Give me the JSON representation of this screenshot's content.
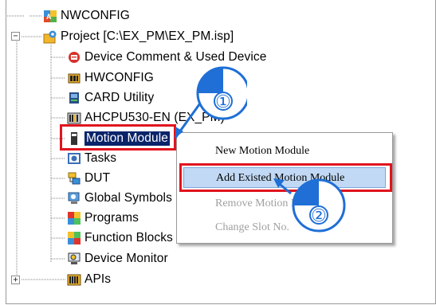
{
  "tree": {
    "items": [
      {
        "label": "NWCONFIG",
        "icon": "network-config-icon"
      },
      {
        "label": "Project [C:\\EX_PM\\EX_PM.isp]",
        "icon": "project-icon",
        "expander": "−"
      },
      {
        "label": "Device Comment & Used Device",
        "icon": "device-comment-icon"
      },
      {
        "label": "HWCONFIG",
        "icon": "hardware-config-icon"
      },
      {
        "label": "CARD Utility",
        "icon": "card-utility-icon"
      },
      {
        "label": "AHCPU530-EN (EX_PM)",
        "icon": "cpu-module-icon"
      },
      {
        "label": "Motion Module",
        "icon": "motion-module-icon"
      },
      {
        "label": "Tasks",
        "icon": "tasks-icon"
      },
      {
        "label": "DUT",
        "icon": "dut-icon"
      },
      {
        "label": "Global Symbols",
        "icon": "global-symbols-icon"
      },
      {
        "label": "Programs",
        "icon": "programs-icon"
      },
      {
        "label": "Function Blocks",
        "icon": "function-blocks-icon"
      },
      {
        "label": "Device Monitor",
        "icon": "device-monitor-icon"
      },
      {
        "label": "APIs",
        "icon": "apis-icon",
        "expander": "+"
      }
    ]
  },
  "context_menu": {
    "items": [
      {
        "label": "New Motion Module",
        "enabled": true
      },
      {
        "label": "Add Existed Motion Module",
        "enabled": true,
        "highlighted": true
      },
      {
        "label": "Remove Motion Module",
        "enabled": false
      },
      {
        "label": "Change Slot No.",
        "enabled": false
      }
    ]
  },
  "callouts": {
    "step1": "①",
    "step2": "②"
  },
  "colors": {
    "highlight_box": "#e0141e",
    "callout_blue": "#1f6fd6",
    "menu_hover": "#c1d9f4"
  }
}
